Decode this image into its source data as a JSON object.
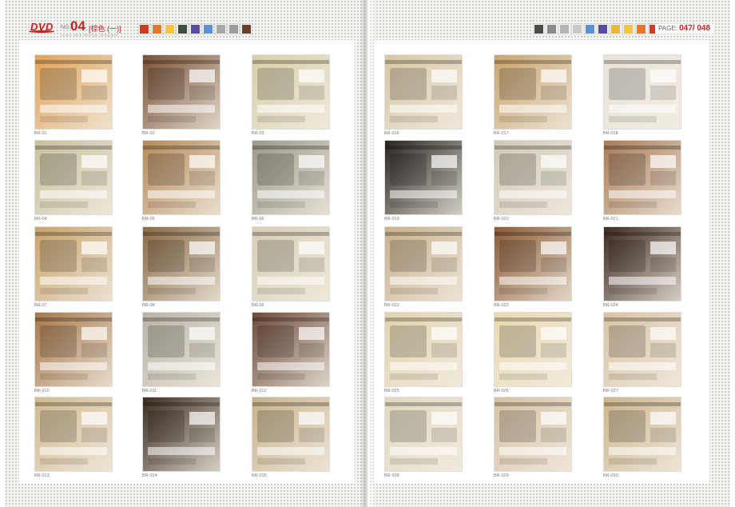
{
  "header_left": {
    "logo": "DVD",
    "no_label": "NO.",
    "no_value": "04",
    "category": "[棕色 (一)]",
    "subline": "cross web design template"
  },
  "header_right": {
    "page_label": "PAGE:",
    "page_current": "047",
    "page_total": "/ 048"
  },
  "swatches_left": [
    "#d23a21",
    "#e8762a",
    "#f2c53b",
    "#3e4b3f",
    "#5a4aa0",
    "#5b8fd6",
    "#a8a8a8",
    "#9c9c9c",
    "#6b3d2b"
  ],
  "swatches_right": [
    "#4a4a4a",
    "#8a8a8a",
    "#b5b5b5",
    "#c8c8c8",
    "#5b8fd6",
    "#5a4aa0",
    "#e8b93a",
    "#f2c53b",
    "#e8762a",
    "#d23a21"
  ],
  "thumbnails": [
    {
      "caption": "BR-01",
      "theme": "#e0a35a"
    },
    {
      "caption": "BR-02",
      "theme": "#7a5236"
    },
    {
      "caption": "BR-03",
      "theme": "#d9cfa9"
    },
    {
      "caption": "BR-04",
      "theme": "#c9c09d"
    },
    {
      "caption": "BR-05",
      "theme": "#b68a58"
    },
    {
      "caption": "BR-06",
      "theme": "#9c988a"
    },
    {
      "caption": "BR-07",
      "theme": "#c9a36b"
    },
    {
      "caption": "BR-08",
      "theme": "#8a6a44"
    },
    {
      "caption": "BR-09",
      "theme": "#d8cdb4"
    },
    {
      "caption": "BR-010",
      "theme": "#a8784a"
    },
    {
      "caption": "BR-011",
      "theme": "#b9b3a6"
    },
    {
      "caption": "BR-012",
      "theme": "#6e4b3a"
    },
    {
      "caption": "BR-013",
      "theme": "#d2b98f"
    },
    {
      "caption": "BR-014",
      "theme": "#3d2d20"
    },
    {
      "caption": "BR-015",
      "theme": "#c9b28a"
    },
    {
      "caption": "BR-016",
      "theme": "#d8c7a5"
    },
    {
      "caption": "BR-017",
      "theme": "#c9a46f"
    },
    {
      "caption": "BR-018",
      "theme": "#e9e3d8"
    },
    {
      "caption": "BR-019",
      "theme": "#2a2521"
    },
    {
      "caption": "BR-020",
      "theme": "#cfc9b6"
    },
    {
      "caption": "BR-021",
      "theme": "#a97b56"
    },
    {
      "caption": "BR-022",
      "theme": "#c9b08a"
    },
    {
      "caption": "BR-023",
      "theme": "#8c5b34"
    },
    {
      "caption": "BR-024",
      "theme": "#3e2a20"
    },
    {
      "caption": "BR-025",
      "theme": "#e3d3ad"
    },
    {
      "caption": "BR-026",
      "theme": "#ead9b0"
    },
    {
      "caption": "BR-027",
      "theme": "#d9c3a4"
    },
    {
      "caption": "BR-028",
      "theme": "#e2d8bf"
    },
    {
      "caption": "BR-029",
      "theme": "#d7c1a3"
    },
    {
      "caption": "BR-030",
      "theme": "#cdb58c"
    }
  ]
}
